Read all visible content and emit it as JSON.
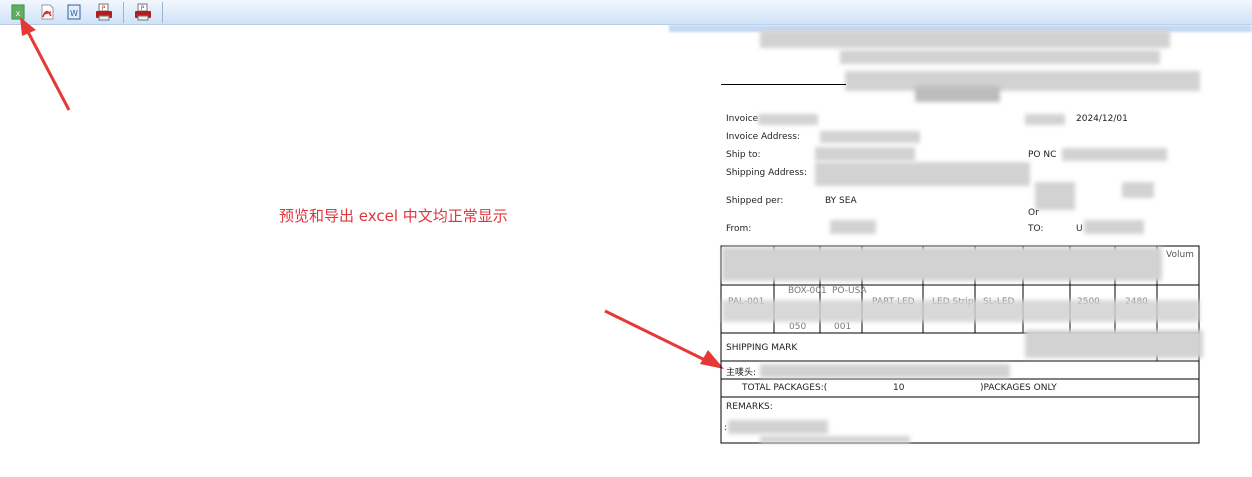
{
  "toolbar": {
    "buttons": [
      {
        "icon": "excel-export-icon"
      },
      {
        "icon": "pdf-export-icon"
      },
      {
        "icon": "word-export-icon"
      },
      {
        "icon": "print-preview-icon"
      },
      {
        "icon": "print-icon"
      }
    ]
  },
  "annotation": {
    "note": "预览和导出 excel 中文均正常显示"
  },
  "invoice": {
    "invoice_label": "Invoice",
    "date_value": "2024/12/01",
    "invoice_address_label": "Invoice  Address:",
    "ship_to_label": "Ship  to:",
    "po_label": "PO  NC",
    "shipping_address_label": "Shipping  Address:",
    "shipped_per_label": "Shipped  per:",
    "shipped_per_value": "BY  SEA",
    "or_label": "Or",
    "from_label": "From:",
    "to_label": "TO:",
    "to_value_prefix": "U",
    "volume_header": "Volum",
    "row_cells": [
      "PAL-001",
      "BOX-001",
      "PO-USA",
      "PART LED",
      "LED Strip",
      "SL-LED",
      "2500",
      "2480"
    ],
    "row_cells_2": [
      "050",
      "001"
    ],
    "shipping_mark_label": "SHIPPING  MARK",
    "main_mark_label": "主唛头:",
    "total_packages_label": "TOTAL  PACKAGES:(",
    "total_packages_value": "10",
    "packages_only_label": ")PACKAGES  ONLY",
    "remarks_label": "REMARKS:",
    "remarks_colon": ":"
  }
}
